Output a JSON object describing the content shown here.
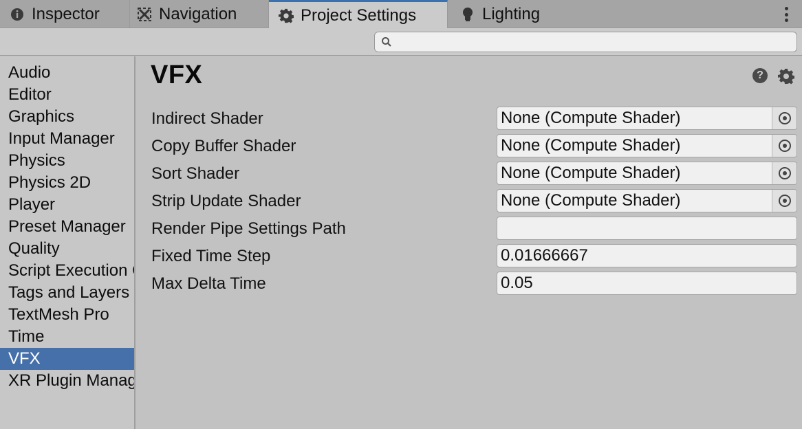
{
  "tabs": [
    {
      "label": "Inspector",
      "icon": "info-icon"
    },
    {
      "label": "Navigation",
      "icon": "navigation-icon"
    },
    {
      "label": "Project Settings",
      "icon": "gear-icon",
      "active": true
    },
    {
      "label": "Lighting",
      "icon": "lightbulb-icon"
    }
  ],
  "search": {
    "placeholder": "",
    "value": ""
  },
  "sidebar": {
    "items": [
      {
        "label": "Audio"
      },
      {
        "label": "Editor"
      },
      {
        "label": "Graphics"
      },
      {
        "label": "Input Manager"
      },
      {
        "label": "Physics"
      },
      {
        "label": "Physics 2D"
      },
      {
        "label": "Player"
      },
      {
        "label": "Preset Manager"
      },
      {
        "label": "Quality"
      },
      {
        "label": "Script Execution Order"
      },
      {
        "label": "Tags and Layers"
      },
      {
        "label": "TextMesh Pro"
      },
      {
        "label": "Time"
      },
      {
        "label": "VFX",
        "selected": true
      },
      {
        "label": "XR Plugin Management"
      }
    ]
  },
  "main": {
    "title": "VFX",
    "fields": [
      {
        "label": "Indirect Shader",
        "value": "None (Compute Shader)",
        "object_picker": true
      },
      {
        "label": "Copy Buffer Shader",
        "value": "None (Compute Shader)",
        "object_picker": true
      },
      {
        "label": "Sort Shader",
        "value": "None (Compute Shader)",
        "object_picker": true
      },
      {
        "label": "Strip Update Shader",
        "value": "None (Compute Shader)",
        "object_picker": true
      },
      {
        "label": "Render Pipe Settings Path",
        "value": ""
      },
      {
        "label": "Fixed Time Step",
        "value": "0.01666667"
      },
      {
        "label": "Max Delta Time",
        "value": "0.05"
      }
    ]
  },
  "colors": {
    "accent": "#3a72b0",
    "selection": "#4670aa",
    "background": "#c2c2c2"
  }
}
